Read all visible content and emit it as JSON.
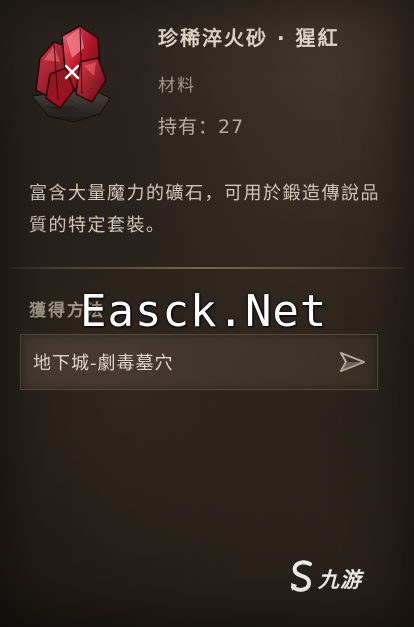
{
  "item": {
    "name": "珍稀淬火砂 · 猩紅",
    "type": "材料",
    "count_text": "持有：27",
    "icon": "red-crystal-ore-icon",
    "description": "富含大量魔力的礦石，可用於鍛造傳說品質的特定套裝。"
  },
  "acquisition": {
    "title": "獲得方法",
    "sources": [
      {
        "label": "地下城-劇毒墓穴",
        "icon": "navigate-arrow-icon"
      }
    ]
  },
  "watermark": "Easck.Net",
  "site_logo": {
    "mark": "S",
    "text": "九游"
  },
  "colors": {
    "background": "#231d18",
    "title": "#e6ddcf",
    "body_text": "#d0c7b9",
    "muted_text": "#a2988a",
    "crystal_red": "#b01c2a"
  }
}
